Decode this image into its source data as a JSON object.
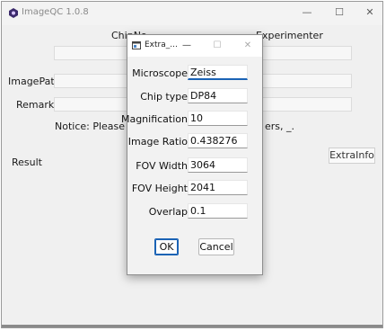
{
  "app": {
    "title": "ImageQC 1.0.8",
    "window_controls": {
      "minimize": "—",
      "maximize": "☐",
      "close": "✕"
    }
  },
  "main_form": {
    "chipno_label": "ChipNo",
    "experimenter_label": "Experimenter",
    "imagepath_label": "ImagePath",
    "remark_label": "Remark",
    "notice_left": "Notice: Please inpu",
    "notice_right": "ers, _.",
    "result_label": "Result",
    "extrainfo_button": "ExtraInfo"
  },
  "dialog": {
    "title": "Extra_...",
    "window_controls": {
      "minimize": "—",
      "maximize": "☐",
      "close": "✕"
    },
    "fields": [
      {
        "label": "Microscope",
        "value": "Zeiss"
      },
      {
        "label": "Chip type",
        "value": "DP84"
      },
      {
        "label": "Magnification",
        "value": "10"
      },
      {
        "label": "Image Ratio",
        "value": "0.438276"
      },
      {
        "label": "FOV Width",
        "value": "3064"
      },
      {
        "label": "FOV Height",
        "value": "2041"
      },
      {
        "label": "Overlap",
        "value": "0.1"
      }
    ],
    "ok_button": "OK",
    "cancel_button": "Cancel"
  },
  "colors": {
    "accent": "#1b63b5",
    "window_bg": "#f0f0f0",
    "dialog_bg": "#f2f2f2"
  }
}
